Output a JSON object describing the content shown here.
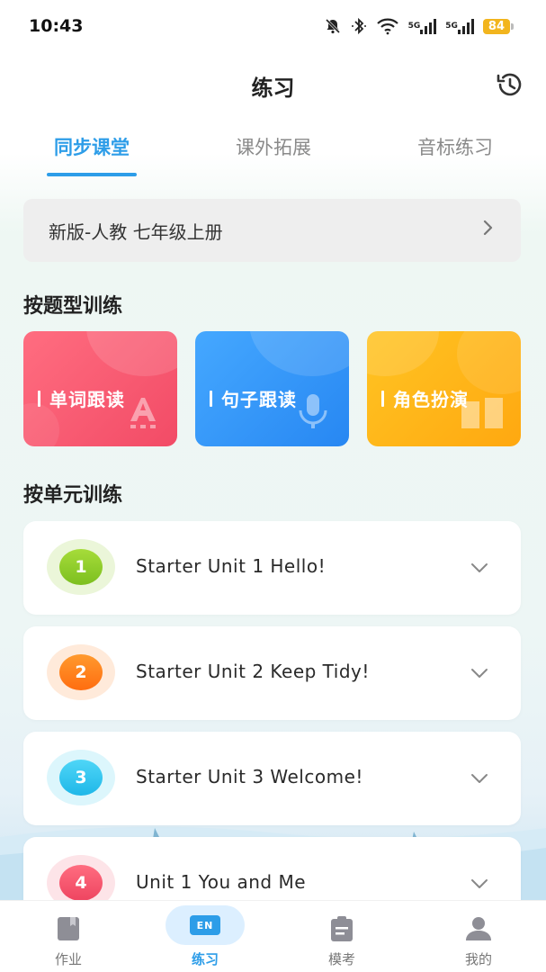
{
  "status_bar": {
    "time": "10:43",
    "battery": "84",
    "signal_1": "5G",
    "signal_2": "5G",
    "icons": [
      "mute-icon",
      "bluetooth-icon",
      "wifi-icon",
      "signal-icon",
      "signal-icon",
      "battery-icon"
    ]
  },
  "header": {
    "title": "练习",
    "history_icon": "history-icon"
  },
  "tabs": [
    {
      "label": "同步课堂",
      "active": true
    },
    {
      "label": "课外拓展",
      "active": false
    },
    {
      "label": "音标练习",
      "active": false
    }
  ],
  "textbook": {
    "label": "新版-人教 七年级上册",
    "icon": "chevron-right-icon"
  },
  "by_type": {
    "title": "按题型训练",
    "cards": [
      {
        "label": "单词跟读",
        "color": "#f4566d",
        "icon": "letter-a-icon"
      },
      {
        "label": "句子跟读",
        "color": "#3598fb",
        "icon": "microphone-icon"
      },
      {
        "label": "角色扮演",
        "color": "#ffb51a",
        "icon": "book-icon"
      }
    ]
  },
  "by_unit": {
    "title": "按单元训练",
    "units": [
      {
        "number": "1",
        "title": "Starter Unit 1 Hello!",
        "color": "#8ecb2a"
      },
      {
        "number": "2",
        "title": "Starter Unit 2 Keep Tidy!",
        "color": "#ff7a1a"
      },
      {
        "number": "3",
        "title": "Starter Unit 3 Welcome!",
        "color": "#27c6ef"
      },
      {
        "number": "4",
        "title": "Unit 1 You and Me",
        "color": "#f4566d"
      }
    ]
  },
  "bottom_nav": [
    {
      "label": "作业",
      "icon": "homework-icon",
      "active": false
    },
    {
      "label": "练习",
      "icon": "en-practice-icon",
      "badge_text": "EN",
      "active": true
    },
    {
      "label": "模考",
      "icon": "exam-clipboard-icon",
      "active": false
    },
    {
      "label": "我的",
      "icon": "profile-icon",
      "active": false
    }
  ],
  "colors": {
    "accent": "#2d9de8",
    "text_primary": "#222222",
    "text_secondary": "#8a8a8a"
  }
}
